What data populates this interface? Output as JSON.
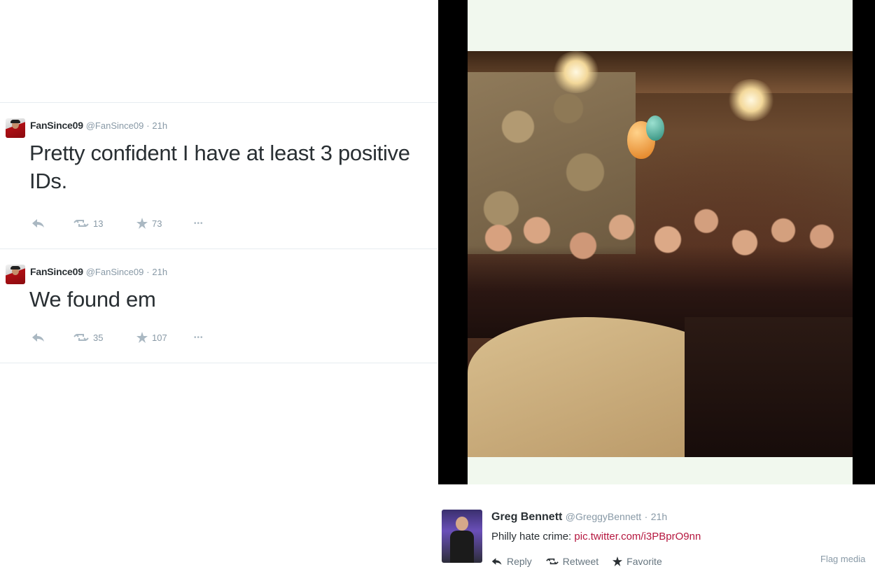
{
  "tweets": [
    {
      "name": "FanSince09",
      "handle": "@FanSince09",
      "time": "21h",
      "text": "Pretty confident I have at least 3 positive IDs.",
      "retweets": "13",
      "favorites": "73"
    },
    {
      "name": "FanSince09",
      "handle": "@FanSince09",
      "time": "21h",
      "text": "We found em",
      "retweets": "35",
      "favorites": "107"
    }
  ],
  "media_tweet": {
    "name": "Greg Bennett",
    "handle": "@GreggyBennett",
    "time": "21h",
    "text": "Philly hate crime:",
    "link": "pic.twitter.com/i3PBprO9nn",
    "actions": {
      "reply": "Reply",
      "retweet": "Retweet",
      "favorite": "Favorite"
    },
    "flag_label": "Flag media"
  },
  "separator": "·",
  "more_glyph": "•••",
  "colors": {
    "link": "#b5173f",
    "muted": "#8899a6",
    "icon": "#aab8c2"
  }
}
